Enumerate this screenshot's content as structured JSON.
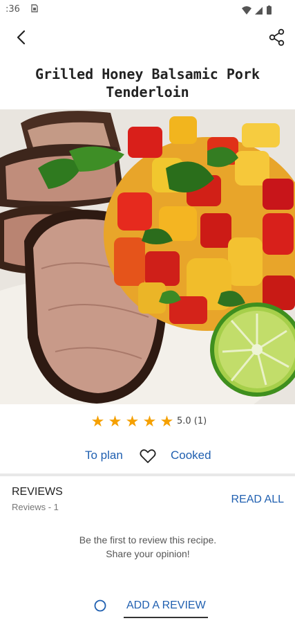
{
  "status_bar": {
    "time": ":36",
    "sim_icon": "sim-card-icon",
    "icons": [
      "wifi-icon",
      "signal-icon",
      "battery-icon"
    ]
  },
  "toolbar": {
    "back_icon": "arrow-back-icon",
    "share_icon": "share-icon"
  },
  "recipe": {
    "title": "Grilled Honey Balsamic Pork Tenderloin",
    "image_alt": "pork-tenderloin-with-mango-salsa-photo"
  },
  "rating": {
    "stars": 5,
    "value_text": "5.0 (1)",
    "star_color": "#f5a000"
  },
  "actions": {
    "plan_label": "To plan",
    "favorite_icon": "heart-outline-icon",
    "cooked_label": "Cooked"
  },
  "reviews": {
    "header": "REVIEWS",
    "count_text": "Reviews - 1",
    "read_all_label": "READ ALL",
    "empty_message": "Be the first to review this recipe. Share your opinion!",
    "add_review_label": "ADD A REVIEW",
    "add_review_icon": "circle-outline-icon"
  },
  "colors": {
    "accent": "#1f5fb0",
    "text": "#222222"
  }
}
